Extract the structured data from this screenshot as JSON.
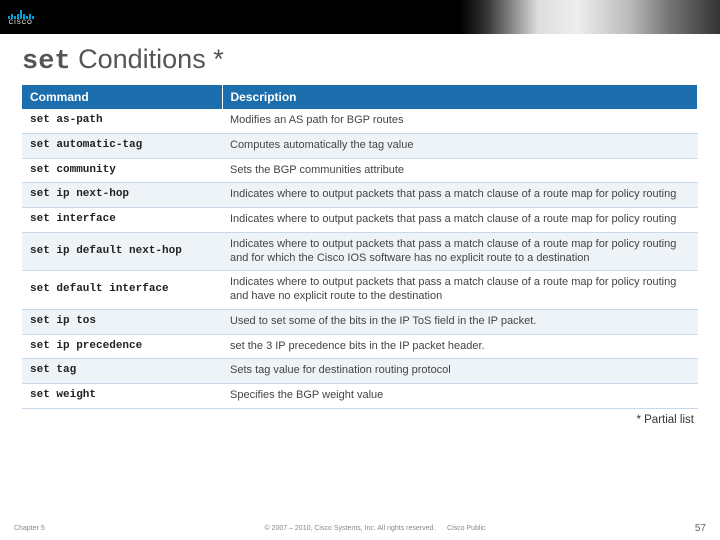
{
  "logo_text": "CISCO",
  "title_prefix": "set",
  "title_suffix": " Conditions *",
  "headers": {
    "command": "Command",
    "description": "Description"
  },
  "rows": [
    {
      "command": "set as-path",
      "description": "Modifies an AS path for BGP routes"
    },
    {
      "command": "set automatic-tag",
      "description": "Computes automatically the tag value"
    },
    {
      "command": "set community",
      "description": "Sets the BGP communities attribute"
    },
    {
      "command": "set ip next-hop",
      "description": "Indicates where to output packets that pass a match clause of a route map for policy routing"
    },
    {
      "command": "set interface",
      "description": "Indicates where to output packets that pass a match clause of a route map for policy routing"
    },
    {
      "command": "set ip default next-hop",
      "description": "Indicates where to output packets that pass a match clause of a route map for policy routing and for which the Cisco IOS software has no explicit route to a destination"
    },
    {
      "command": "set default interface",
      "description": "Indicates where to output packets that pass a match clause of a route map for policy routing and have no explicit route to the destination"
    },
    {
      "command": "set ip tos",
      "description": "Used to set some of the bits in the IP ToS field in the IP packet."
    },
    {
      "command": "set ip precedence",
      "description": "set the 3 IP precedence bits in the IP packet header."
    },
    {
      "command": "set tag",
      "description": "Sets tag value for destination routing protocol"
    },
    {
      "command": "set weight",
      "description": "Specifies the BGP weight value"
    }
  ],
  "footnote": "* Partial list",
  "footer": {
    "chapter": "Chapter 5",
    "copyright": "© 2007 – 2010, Cisco Systems, Inc. All rights reserved.",
    "public": "Cisco Public",
    "page": "57"
  }
}
